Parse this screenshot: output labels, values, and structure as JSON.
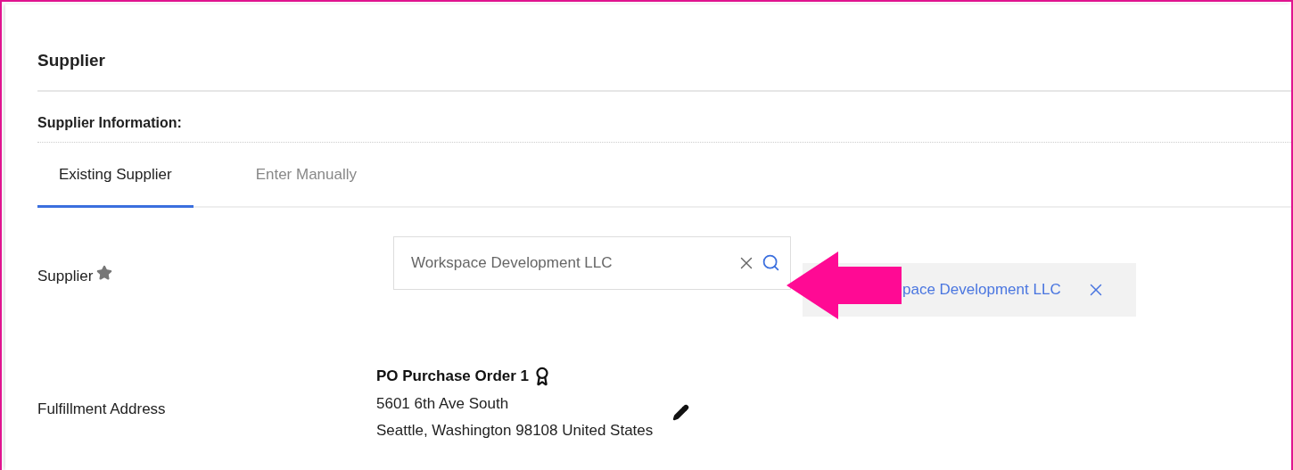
{
  "section": {
    "title": "Supplier",
    "subtitle": "Supplier Information:"
  },
  "tabs": [
    {
      "label": "Existing Supplier",
      "selected": true
    },
    {
      "label": "Enter Manually",
      "selected": false
    }
  ],
  "supplier": {
    "label": "Supplier",
    "required": true,
    "value": "Workspace Development LLC",
    "chip": "pace Development LLC"
  },
  "fulfillment": {
    "label": "Fulfillment Address",
    "name": "PO Purchase Order 1",
    "lines": [
      "5601 6th Ave South",
      "Seattle, Washington 98108 United States"
    ]
  }
}
